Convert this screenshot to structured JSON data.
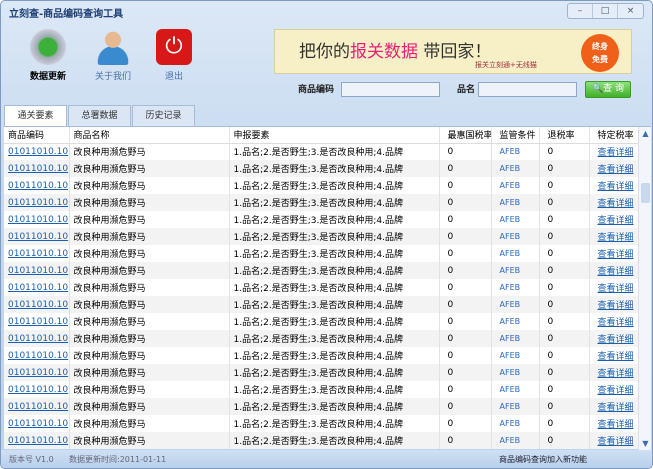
{
  "window": {
    "title": "立刻查-商品编码查询工具",
    "min": "–",
    "max": "□",
    "close": "×"
  },
  "toolbar": {
    "update": "数据更新",
    "about": "关于我们",
    "exit": "退出"
  },
  "banner": {
    "pre": "把你的",
    "highlight": "报关数据",
    "post": "带回家！",
    "sub": "报关立刻通+无线猫",
    "badge1": "终身",
    "badge2": "免费"
  },
  "search": {
    "code_label": "商品编码",
    "code_value": "",
    "name_label": "品名",
    "name_value": "",
    "button": "查 询"
  },
  "tabs": [
    "通关要素",
    "总署数据",
    "历史记录"
  ],
  "table": {
    "headers": [
      "商品编码",
      "商品名称",
      "申报要素",
      "最惠国税率",
      "监管条件",
      "退税率",
      "特定税率"
    ],
    "rows": [
      [
        "01011010.10",
        "改良种用濒危野马",
        "1.品名;2.是否野生;3.是否改良种用;4.品牌",
        "0",
        "AFEB",
        "0",
        "查看详细"
      ],
      [
        "01011010.10",
        "改良种用濒危野马",
        "1.品名;2.是否野生;3.是否改良种用;4.品牌",
        "0",
        "AFEB",
        "0",
        "查看详细"
      ],
      [
        "01011010.10",
        "改良种用濒危野马",
        "1.品名;2.是否野生;3.是否改良种用;4.品牌",
        "0",
        "AFEB",
        "0",
        "查看详细"
      ],
      [
        "01011010.10",
        "改良种用濒危野马",
        "1.品名;2.是否野生;3.是否改良种用;4.品牌",
        "0",
        "AFEB",
        "0",
        "查看详细"
      ],
      [
        "01011010.10",
        "改良种用濒危野马",
        "1.品名;2.是否野生;3.是否改良种用;4.品牌",
        "0",
        "AFEB",
        "0",
        "查看详细"
      ],
      [
        "01011010.10",
        "改良种用濒危野马",
        "1.品名;2.是否野生;3.是否改良种用;4.品牌",
        "0",
        "AFEB",
        "0",
        "查看详细"
      ],
      [
        "01011010.10",
        "改良种用濒危野马",
        "1.品名;2.是否野生;3.是否改良种用;4.品牌",
        "0",
        "AFEB",
        "0",
        "查看详细"
      ],
      [
        "01011010.10",
        "改良种用濒危野马",
        "1.品名;2.是否野生;3.是否改良种用;4.品牌",
        "0",
        "AFEB",
        "0",
        "查看详细"
      ],
      [
        "01011010.10",
        "改良种用濒危野马",
        "1.品名;2.是否野生;3.是否改良种用;4.品牌",
        "0",
        "AFEB",
        "0",
        "查看详细"
      ],
      [
        "01011010.10",
        "改良种用濒危野马",
        "1.品名;2.是否野生;3.是否改良种用;4.品牌",
        "0",
        "AFEB",
        "0",
        "查看详细"
      ],
      [
        "01011010.10",
        "改良种用濒危野马",
        "1.品名;2.是否野生;3.是否改良种用;4.品牌",
        "0",
        "AFEB",
        "0",
        "查看详细"
      ],
      [
        "01011010.10",
        "改良种用濒危野马",
        "1.品名;2.是否野生;3.是否改良种用;4.品牌",
        "0",
        "AFEB",
        "0",
        "查看详细"
      ],
      [
        "01011010.10",
        "改良种用濒危野马",
        "1.品名;2.是否野生;3.是否改良种用;4.品牌",
        "0",
        "AFEB",
        "0",
        "查看详细"
      ],
      [
        "01011010.10",
        "改良种用濒危野马",
        "1.品名;2.是否野生;3.是否改良种用;4.品牌",
        "0",
        "AFEB",
        "0",
        "查看详细"
      ],
      [
        "01011010.10",
        "改良种用濒危野马",
        "1.品名;2.是否野生;3.是否改良种用;4.品牌",
        "0",
        "AFEB",
        "0",
        "查看详细"
      ],
      [
        "01011010.10",
        "改良种用濒危野马",
        "1.品名;2.是否野生;3.是否改良种用;4.品牌",
        "0",
        "AFEB",
        "0",
        "查看详细"
      ],
      [
        "01011010.10",
        "改良种用濒危野马",
        "1.品名;2.是否野生;3.是否改良种用;4.品牌",
        "0",
        "AFEB",
        "0",
        "查看详细"
      ],
      [
        "01011010.10",
        "改良种用濒危野马",
        "1.品名;2.是否野生;3.是否改良种用;4.品牌",
        "0",
        "AFEB",
        "0",
        "查看详细"
      ]
    ]
  },
  "status": {
    "version": "版本号 V1.0",
    "updated": "数据更新时间:2011-01-11",
    "notice": "商品编码查询加入新功能"
  },
  "colors": {
    "link": "#1a5fb0",
    "banner_highlight": "#e8207a",
    "query_button": "#3fb02a"
  }
}
